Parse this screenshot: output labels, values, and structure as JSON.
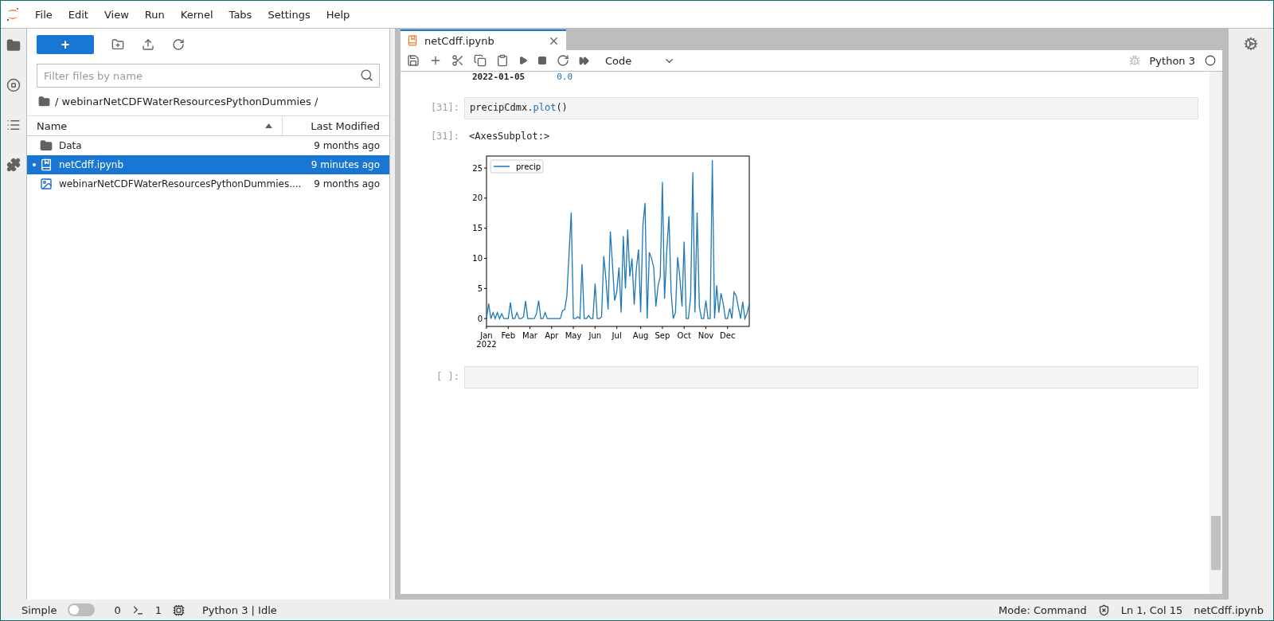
{
  "menu": [
    "File",
    "Edit",
    "View",
    "Run",
    "Kernel",
    "Tabs",
    "Settings",
    "Help"
  ],
  "file_browser": {
    "new_button": "+",
    "filter": {
      "placeholder": "Filter files by name"
    },
    "breadcrumb": "/ webinarNetCDFWaterResourcesPythonDummies /",
    "columns": [
      {
        "label": "Name",
        "sorted": true
      },
      {
        "label": "Last Modified",
        "sorted": false
      }
    ],
    "files": [
      {
        "kind": "folder",
        "name": "Data",
        "modified": "9 months ago",
        "selected": false,
        "running": false
      },
      {
        "kind": "notebook",
        "name": "netCdff.ipynb",
        "modified": "9 minutes ago",
        "selected": true,
        "running": true
      },
      {
        "kind": "image",
        "name": "webinarNetCDFWaterResourcesPythonDummies....",
        "modified": "9 months ago",
        "selected": false,
        "running": false
      }
    ]
  },
  "notebook": {
    "tab": {
      "title": "netCdff.ipynb"
    },
    "cell_type": "Code",
    "kernel": "Python 3",
    "partial_output": [
      "2022-01-05",
      "0.0"
    ],
    "cells": [
      {
        "kind": "code",
        "prompt": "[31]:",
        "source": [
          {
            "text": "precipCdmx."
          },
          {
            "text": "plot",
            "kind": "name"
          },
          {
            "text": "()"
          }
        ]
      },
      {
        "kind": "output",
        "prompt": "[31]:",
        "text": "<AxesSubplot:>",
        "chart_data": {
          "type": "line",
          "ylim": [
            -1.3,
            27
          ],
          "yticks": [
            0,
            5,
            10,
            15,
            20,
            25
          ],
          "categories": [
            "Jan\n2022",
            null,
            null,
            null,
            null,
            null,
            null,
            null,
            null,
            null,
            "Feb",
            null,
            null,
            null,
            null,
            null,
            null,
            null,
            null,
            null,
            "Mar",
            null,
            null,
            null,
            null,
            null,
            null,
            null,
            null,
            null,
            "Apr",
            null,
            null,
            null,
            null,
            null,
            null,
            null,
            null,
            null,
            "May",
            null,
            null,
            null,
            null,
            null,
            null,
            null,
            null,
            null,
            "Jun",
            null,
            null,
            null,
            null,
            null,
            null,
            null,
            null,
            null,
            "Jul",
            null,
            null,
            null,
            null,
            null,
            null,
            null,
            null,
            null,
            null,
            "Aug",
            null,
            null,
            null,
            null,
            null,
            null,
            null,
            null,
            null,
            "Sep",
            null,
            null,
            null,
            null,
            null,
            null,
            null,
            null,
            null,
            "Oct",
            null,
            null,
            null,
            null,
            null,
            null,
            null,
            null,
            null,
            "Nov",
            null,
            null,
            null,
            null,
            null,
            null,
            null,
            null,
            null,
            "Dec",
            null,
            null,
            null,
            null,
            null,
            null,
            null,
            null,
            null,
            null
          ],
          "series": [
            {
              "name": "precip",
              "color": "#1f77b4",
              "values": [
                0,
                2.5,
                0,
                1,
                0,
                1,
                0,
                0.8,
                0,
                0,
                0,
                2.7,
                0,
                0,
                1,
                0,
                0,
                0.3,
                2.9,
                0,
                0,
                0,
                0,
                0.8,
                3,
                0,
                0,
                1,
                0,
                0,
                0,
                0,
                0,
                0,
                0,
                1.3,
                1.5,
                3.7,
                10.6,
                17.6,
                0,
                0,
                0.3,
                0,
                9,
                0,
                0,
                0.5,
                0,
                0,
                5.8,
                0,
                0,
                0.3,
                10.4,
                6.5,
                1.5,
                14.5,
                9,
                3,
                4.5,
                8.5,
                1,
                13.7,
                5,
                14.8,
                7,
                10,
                2.3,
                8.3,
                11.5,
                1,
                15.5,
                19.2,
                0,
                11,
                10,
                8.5,
                2,
                5.5,
                7,
                22.7,
                3.3,
                11.3,
                17,
                4.5,
                0,
                1,
                10.2,
                7,
                2,
                12.8,
                0,
                0,
                3.8,
                24.3,
                1,
                17.6,
                2,
                0,
                0,
                3,
                0,
                0,
                26.3,
                0,
                5.5,
                1,
                4.2,
                2.5,
                0,
                0,
                1.7,
                0,
                4.4,
                3.8,
                1.8,
                0,
                2.8,
                0,
                0.9,
                2.5
              ]
            }
          ]
        }
      },
      {
        "kind": "code",
        "prompt": "[ ]:"
      }
    ]
  },
  "status_bar": {
    "simple_mode": {
      "label": "Simple",
      "on": false
    },
    "terminals": "0",
    "kernels": "1",
    "kernel_status": "Python 3 | Idle",
    "mode": "Mode: Command",
    "cursor": "Ln 1, Col 15",
    "file": "netCdff.ipynb"
  }
}
